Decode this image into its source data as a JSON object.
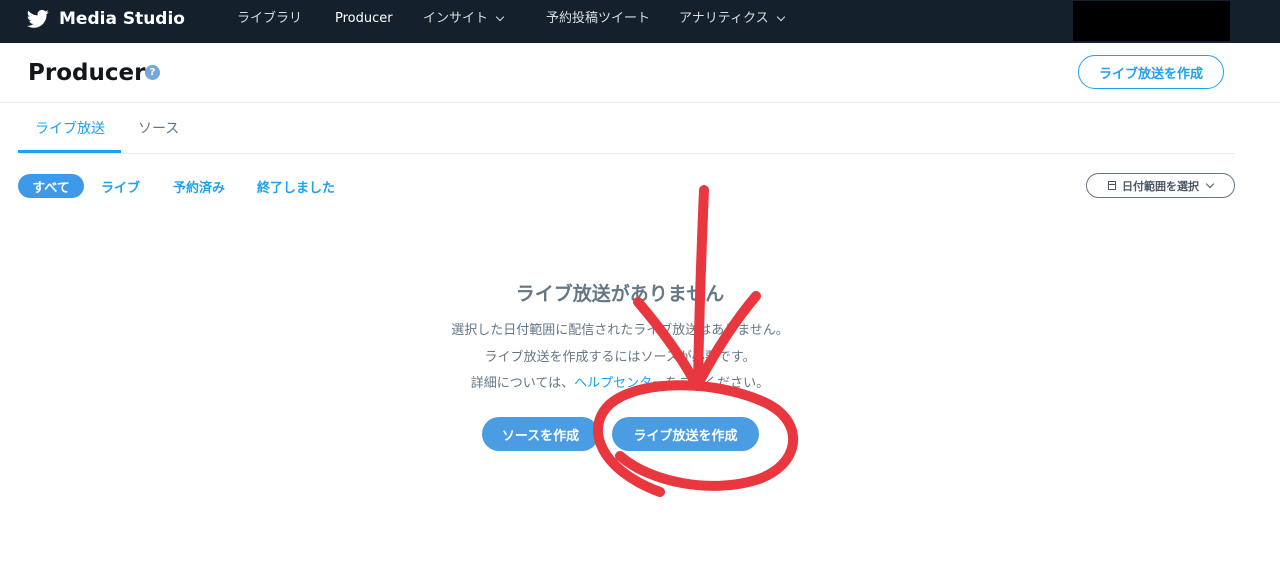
{
  "nav": {
    "brand": "Media Studio",
    "items": [
      {
        "label": "ライブラリ"
      },
      {
        "label": "Producer"
      },
      {
        "label": "インサイト"
      },
      {
        "label": "予約投稿ツイート"
      },
      {
        "label": "アナリティクス"
      }
    ]
  },
  "header": {
    "title": "Producer",
    "help_glyph": "?",
    "create_button": "ライブ放送を作成"
  },
  "tabs": [
    {
      "label": "ライブ放送",
      "active": true
    },
    {
      "label": "ソース",
      "active": false
    }
  ],
  "filters": {
    "pills": [
      {
        "label": "すべて",
        "active": true
      },
      {
        "label": "ライブ"
      },
      {
        "label": "予約済み"
      },
      {
        "label": "終了しました"
      }
    ],
    "date_range_label": "日付範囲を選択"
  },
  "empty_state": {
    "title": "ライブ放送がありません",
    "line1": "選択した日付範囲に配信されたライブ放送はありません。",
    "line2": "ライブ放送を作成するにはソースが必要です。",
    "line3_prefix": "詳細については、",
    "line3_link": "ヘルプセンター",
    "line3_suffix": "をご覧ください。",
    "create_source_button": "ソースを作成",
    "create_live_button": "ライブ放送を作成"
  },
  "colors": {
    "nav_bg": "#14202b",
    "accent": "#1da1f2",
    "annotation": "#e8373f"
  }
}
